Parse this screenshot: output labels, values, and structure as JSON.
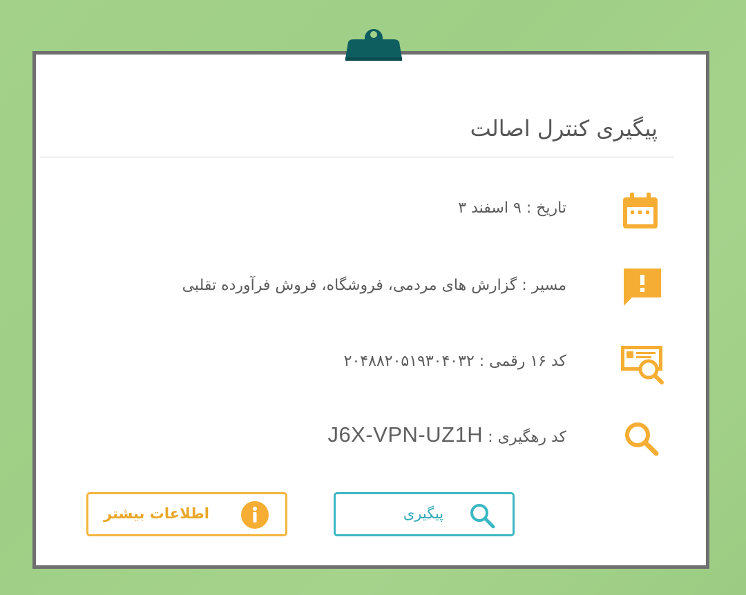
{
  "header": {
    "title": "پیگیری کنترل اصالت"
  },
  "rows": [
    {
      "icon": "calendar-icon",
      "label": "تاریخ :",
      "value": "۹ اسفند ۳"
    },
    {
      "icon": "report-alert-icon",
      "label": "مسیر :",
      "value": "گزارش های مردمی، فروشگاه، فروش فرآورده تقلبی"
    },
    {
      "icon": "code-search-icon",
      "label": "کد ۱۶ رقمی :",
      "value": "۲۰۴۸۸۲۰۵۱۹۳۰۴۰۳۲"
    },
    {
      "icon": "search-icon",
      "label": "کد رهگیری :",
      "value": "J6X-VPN-UZ1H"
    }
  ],
  "buttons": {
    "track_label": "پیگیری",
    "more_info_label": "اطلاعات بیشتر"
  },
  "colors": {
    "background": "#a3d18a",
    "icon_orange": "#f5ae33",
    "track_teal": "#3ab7c3",
    "clip_teal": "#0e5e60",
    "card_border": "#6f6f6f"
  }
}
